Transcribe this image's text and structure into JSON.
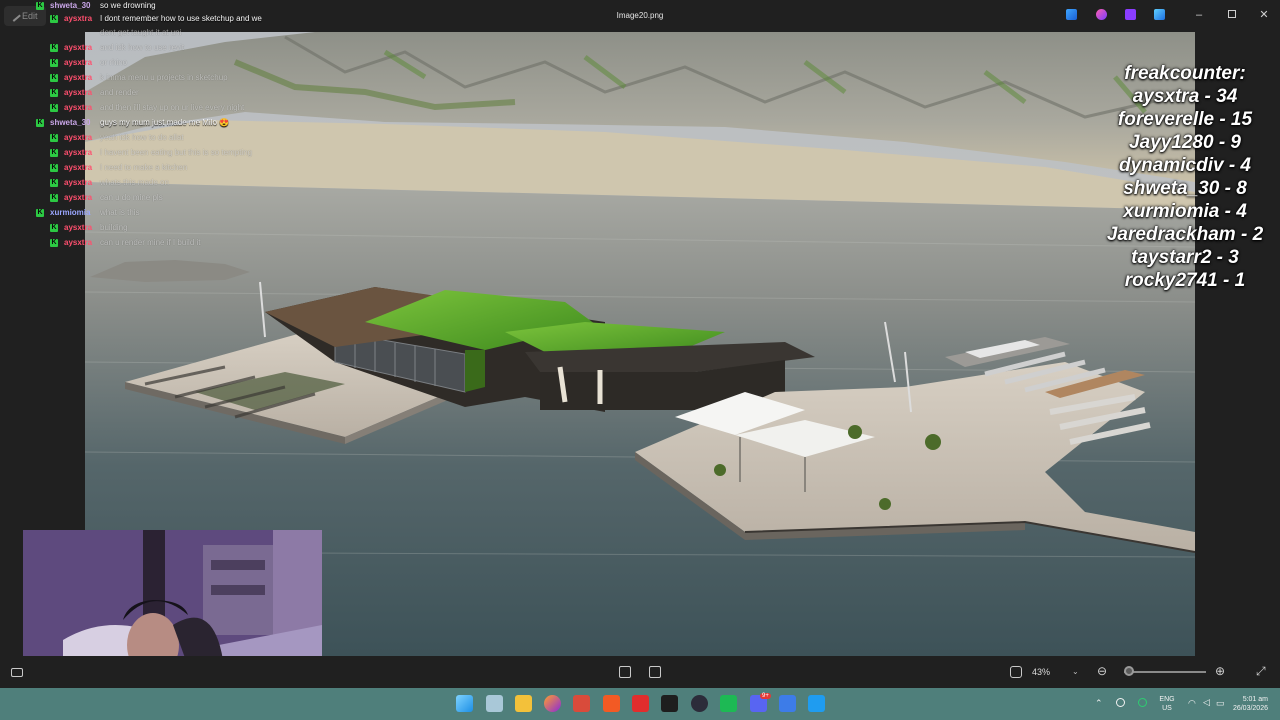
{
  "window": {
    "title": "Image20.png",
    "edit_label": "Edit",
    "controls": [
      "minimize-button",
      "maximize-button",
      "close-button"
    ],
    "titlebar_apps": [
      "app-icon-1",
      "app-icon-2",
      "app-icon-3",
      "app-icon-4"
    ]
  },
  "chat": {
    "messages": [
      {
        "user": "shweta_30",
        "user_color": "#c9a6e8",
        "text": "so we drowning"
      },
      {
        "user": "aysxtra",
        "user_color": "#ff4f6e",
        "text": "I dont remember how to use sketchup and we"
      },
      {
        "user": "",
        "user_color": "",
        "text": "dont get taught it at uni"
      },
      {
        "user": "aysxtra",
        "user_color": "#ff4f6e",
        "text": "and idk how to use revit"
      },
      {
        "user": "aysxtra",
        "user_color": "#ff4f6e",
        "text": "or rhino"
      },
      {
        "user": "aysxtra",
        "user_color": "#ff4f6e",
        "text": "k imma menu u projects in sketchup"
      },
      {
        "user": "aysxtra",
        "user_color": "#ff4f6e",
        "text": "and render"
      },
      {
        "user": "aysxtra",
        "user_color": "#ff4f6e",
        "text": "and then i'll stay up on ur live every night"
      },
      {
        "user": "shweta_30",
        "user_color": "#c9a6e8",
        "text": "guys my mum just made me Milo 😍"
      },
      {
        "user": "aysxtra",
        "user_color": "#ff4f6e",
        "text": "yeah idk how to do allat"
      },
      {
        "user": "aysxtra",
        "user_color": "#ff4f6e",
        "text": "I havent been eating but this is so tempting"
      },
      {
        "user": "aysxtra",
        "user_color": "#ff4f6e",
        "text": "I need to make a kitchen"
      },
      {
        "user": "aysxtra",
        "user_color": "#ff4f6e",
        "text": "whats this made on"
      },
      {
        "user": "aysxtra",
        "user_color": "#ff4f6e",
        "text": "can u do mine pls"
      },
      {
        "user": "xurmiomia",
        "user_color": "#9aa6ff",
        "text": "what is this"
      },
      {
        "user": "aysxtra",
        "user_color": "#ff4f6e",
        "text": "building"
      },
      {
        "user": "aysxtra",
        "user_color": "#ff4f6e",
        "text": "can u render mine if I build it"
      }
    ]
  },
  "freakcounter": {
    "title": "freakcounter:",
    "entries": [
      "aysxtra - 34",
      "foreverelle - 15",
      "Jayy1280 - 9",
      "dynamicdiv - 4",
      "shweta_30 - 8",
      "xurmiomia - 4",
      "Jaredrackham - 2",
      "taystarr2 - 3",
      "rocky2741 - 1"
    ]
  },
  "viewer": {
    "zoom": "43%",
    "zoom_fraction": 0.05
  },
  "taskbar": {
    "apps": [
      "start-button",
      "widgets-button",
      "file-explorer-icon",
      "firefox-icon",
      "stream-app-icon",
      "brave-icon",
      "red-app-icon",
      "figma-icon",
      "obs-icon",
      "spotify-icon",
      "discord-icon",
      "photos-icon",
      "blue-app-icon"
    ],
    "language": "ENG",
    "region": "US",
    "time": "5:01 am",
    "date": "26/03/2026",
    "discord_badge": "9+"
  },
  "colors": {
    "chat_badge": "#2cc943",
    "taskbar": "#4f7f7b"
  }
}
